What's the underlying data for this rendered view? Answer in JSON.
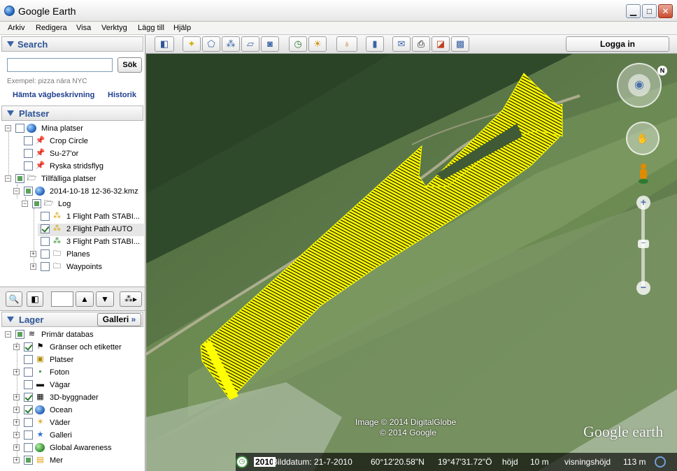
{
  "window": {
    "title": "Google Earth"
  },
  "menu": [
    "Arkiv",
    "Redigera",
    "Visa",
    "Verktyg",
    "Lägg till",
    "Hjälp"
  ],
  "search": {
    "header": "Search",
    "input_value": "",
    "button": "Sök",
    "hint": "Exempel: pizza nära NYC",
    "link_directions": "Hämta vägbeskrivning",
    "link_history": "Historik"
  },
  "places": {
    "header": "Platser",
    "items": [
      {
        "label": "Mina platser"
      },
      {
        "label": "Crop Circle"
      },
      {
        "label": "Su-27'or"
      },
      {
        "label": "Ryska stridsflyg"
      },
      {
        "label": "Tillfälliga platser"
      },
      {
        "label": "2014-10-18 12-36-32.kmz"
      },
      {
        "label": "Log"
      },
      {
        "label": "1 Flight Path STABI..."
      },
      {
        "label": "2 Flight Path AUTO"
      },
      {
        "label": "3 Flight Path STABI..."
      },
      {
        "label": "Planes"
      },
      {
        "label": "Waypoints"
      }
    ]
  },
  "layers": {
    "header": "Lager",
    "gallery_button": "Galleri",
    "gallery_arrows": "»",
    "items": [
      {
        "label": "Primär databas"
      },
      {
        "label": "Gränser och etiketter"
      },
      {
        "label": "Platser"
      },
      {
        "label": "Foton"
      },
      {
        "label": "Vägar"
      },
      {
        "label": "3D-byggnader"
      },
      {
        "label": "Ocean"
      },
      {
        "label": "Väder"
      },
      {
        "label": "Galleri"
      },
      {
        "label": "Global Awareness"
      },
      {
        "label": "Mer"
      }
    ]
  },
  "toolbar": {
    "signin": "Logga in"
  },
  "map": {
    "credit_line1": "Image © 2014 DigitalGlobe",
    "credit_line2": "© 2014 Google",
    "logo": "Google earth",
    "compass_north": "N",
    "zoom_plus": "+",
    "zoom_minus": "−",
    "colors": {
      "track": "#ffff00",
      "track_line": "#1a1a00"
    }
  },
  "status": {
    "year": "2010",
    "imagery_date": "Bilddatum: 21-7-2010",
    "lat": "60°12'20.58\"N",
    "lon": "19°47'31.72\"Ö",
    "elevation_label": "höjd",
    "elevation": "10 m",
    "eye_label": "visningshöjd",
    "eye": "113 m"
  }
}
